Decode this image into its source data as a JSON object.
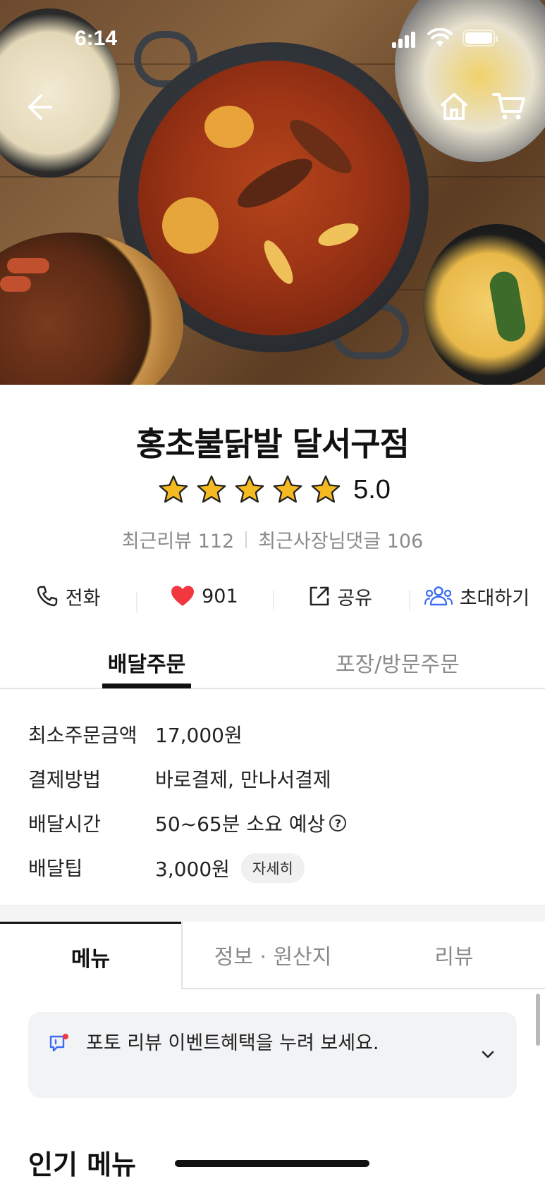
{
  "status_bar": {
    "time": "6:14"
  },
  "store": {
    "name": "홍초불닭발 달서구점",
    "rating": "5.0",
    "stars_filled": 5,
    "recent_reviews_label": "최근리뷰 112",
    "owner_replies_label": "최근사장님댓글 106"
  },
  "actions": {
    "call": "전화",
    "like_count": "901",
    "share": "공유",
    "invite": "초대하기"
  },
  "order_tabs": {
    "delivery": "배달주문",
    "pickup": "포장/방문주문"
  },
  "info": {
    "rows": [
      {
        "key": "최소주문금액",
        "value": "17,000원"
      },
      {
        "key": "결제방법",
        "value": "바로결제, 만나서결제"
      },
      {
        "key": "배달시간",
        "value": "50~65분 소요 예상"
      },
      {
        "key": "배달팁",
        "value": "3,000원"
      }
    ],
    "detail_button": "자세히",
    "help_symbol": "?"
  },
  "menu_tabs": {
    "menu": "메뉴",
    "info_origin": "정보 · 원산지",
    "review": "리뷰"
  },
  "notice": {
    "text": "포토 리뷰 이벤트혜택을 누려 보세요."
  },
  "sections": {
    "popular_menu": "인기 메뉴"
  },
  "colors": {
    "star": "#F5B921",
    "heart": "#F0383E",
    "invite_icon": "#3B6CF6",
    "notice_icon": "#3B6CF6",
    "notice_dot": "#F0383E"
  }
}
